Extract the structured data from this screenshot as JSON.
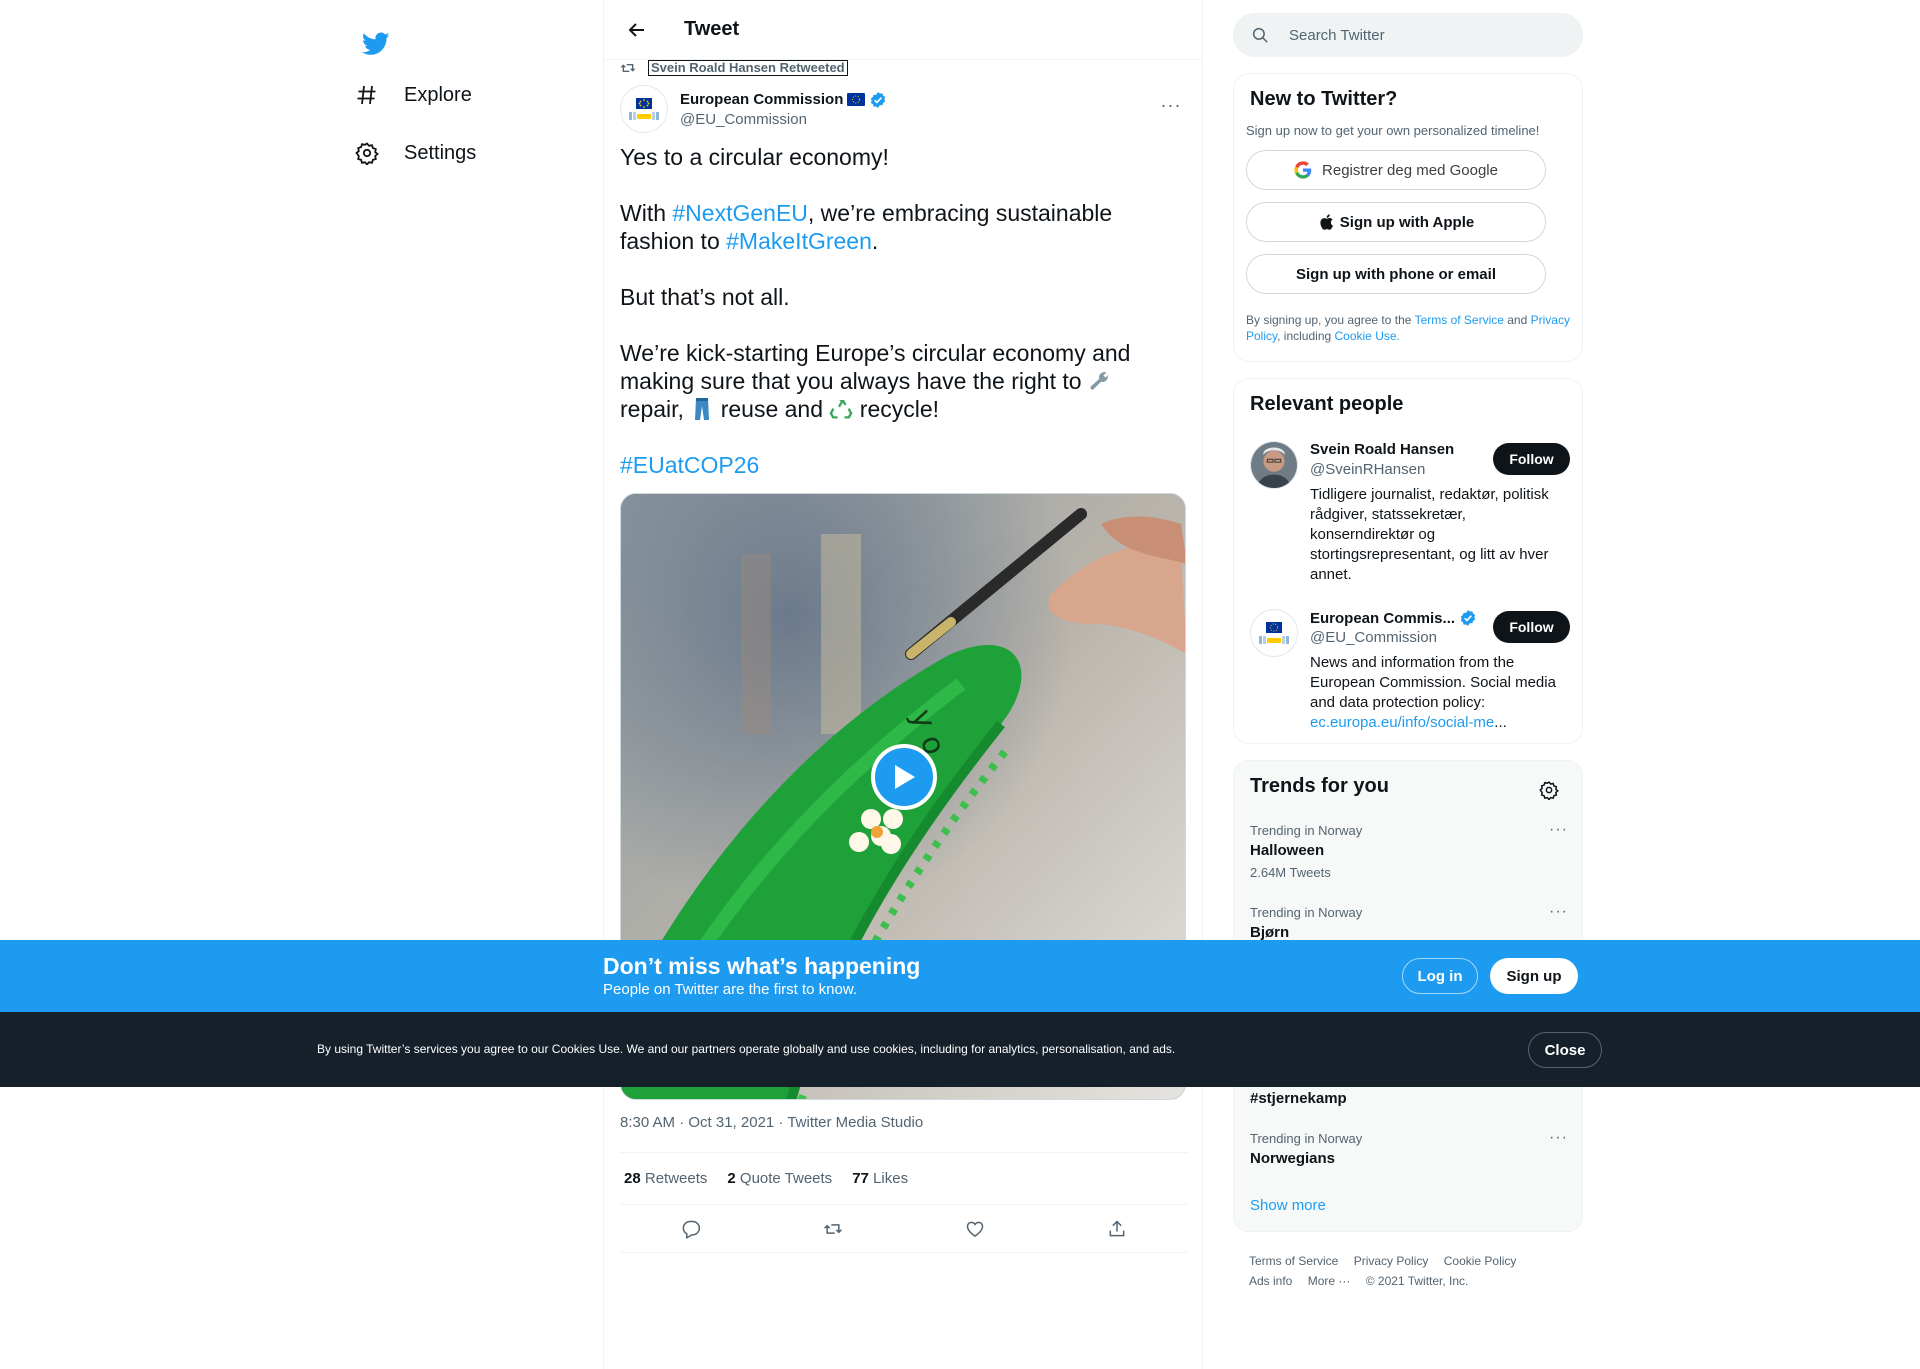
{
  "nav": {
    "logo_icon": "twitter-bird-icon",
    "items": [
      {
        "label": "Explore",
        "icon": "hashtag-icon"
      },
      {
        "label": "Settings",
        "icon": "gear-icon"
      }
    ]
  },
  "header": {
    "title": "Tweet"
  },
  "tweet": {
    "retweeted_by": "Svein Roald Hansen Retweeted",
    "author_name": "European Commission",
    "author_handle": "@EU_Commission",
    "line1": "Yes to a circular economy!",
    "line2_pre": "With ",
    "line2_tag1": "#NextGenEU",
    "line2_mid": ", we’re embracing sustainable fashion to ",
    "line2_tag2": "#MakeItGreen",
    "line2_end": ".",
    "line3": "But that’s not all.",
    "line4_a": "We’re kick-starting Europe’s circular economy and making sure that you always have the right to ",
    "line4_b": " repair, ",
    "line4_c": " reuse and ",
    "line4_d": " recycle!",
    "hashtag": "#EUatCOP26",
    "meta": "8:30 AM · Oct 31, 2021 · Twitter Media Studio",
    "stats": {
      "retweets_count": "28",
      "retweets_label": "Retweets",
      "quotes_count": "2",
      "quotes_label": "Quote Tweets",
      "likes_count": "77",
      "likes_label": "Likes"
    }
  },
  "search": {
    "placeholder": "Search Twitter"
  },
  "signup_card": {
    "title": "New to Twitter?",
    "subtitle": "Sign up now to get your own personalized timeline!",
    "google": "Registrer deg med Google",
    "apple": "Sign up with Apple",
    "phone": "Sign up with phone or email",
    "legal_1": "By signing up, you agree to the ",
    "legal_tos": "Terms of Service",
    "legal_2": " and ",
    "legal_pp": "Privacy Policy",
    "legal_3": ", including ",
    "legal_cu": "Cookie Use."
  },
  "people_card": {
    "title": "Relevant people",
    "people": [
      {
        "name": "Svein Roald Hansen",
        "handle": "@SveinRHansen",
        "bio": "Tidligere journalist, redaktør, politisk rådgiver, statssekretær, konserndirektør og stortingsrepresentant, og litt av hver annet.",
        "follow": "Follow"
      },
      {
        "name": "European Commis...",
        "handle": "@EU_Commission",
        "bio": "News and information from the European Commission. Social media and data protection policy: ",
        "bio_link": "ec.europa.eu/info/social-me",
        "bio_end": "...",
        "follow": "Follow"
      }
    ]
  },
  "trends_card": {
    "title": "Trends for you",
    "trends": [
      {
        "context": "Trending in Norway",
        "name": "Halloween",
        "count": "2.64M Tweets"
      },
      {
        "context": "Trending in Norway",
        "name": "Bjørn",
        "count": ""
      },
      {
        "context": "",
        "name": "#stjernekamp",
        "count": ""
      },
      {
        "context": "Trending in Norway",
        "name": "Norwegians",
        "count": ""
      }
    ],
    "show_more": "Show more"
  },
  "footer": {
    "links": [
      "Terms of Service",
      "Privacy Policy",
      "Cookie Policy",
      "Ads info",
      "More ···",
      "© 2021 Twitter, Inc."
    ]
  },
  "banner": {
    "title": "Don’t miss what’s happening",
    "subtitle": "People on Twitter are the first to know.",
    "login": "Log in",
    "signup": "Sign up"
  },
  "cookie_bar": {
    "text": "By using Twitter’s services you agree to our Cookies Use. We and our partners operate globally and use cookies, including for analytics, personalisation, and ads.",
    "close": "Close"
  },
  "colors": {
    "accent": "#1d9bf0",
    "text": "#0f1419",
    "muted": "#536471",
    "cookie_bg": "#15202b"
  }
}
